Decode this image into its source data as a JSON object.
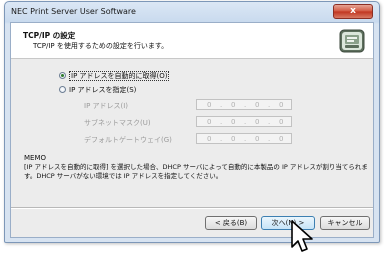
{
  "window": {
    "title": "NEC Print Server User Software",
    "close_label": "x"
  },
  "header": {
    "title": "TCP/IP の設定",
    "subtitle": "TCP/IP を使用するための設定を行います。",
    "icon": "settings-wizard-icon"
  },
  "options": {
    "auto": {
      "label": "IP アドレスを自動的に取得(O)",
      "selected": true
    },
    "manual": {
      "label": "IP アドレスを指定(S)",
      "selected": false
    }
  },
  "fields": [
    {
      "label": "IP アドレス(I)",
      "value": [
        "0",
        "0",
        "0",
        "0"
      ]
    },
    {
      "label": "サブネットマスク(U)",
      "value": [
        "0",
        "0",
        "0",
        "0"
      ]
    },
    {
      "label": "デフォルトゲートウェイ(G)",
      "value": [
        "0",
        "0",
        "0",
        "0"
      ]
    }
  ],
  "memo": {
    "title": "MEMO",
    "text": "[IP アドレスを自動的に取得] を選択した場合、DHCP サーバによって自動的に本製品の IP アドレスが割り当てられます。DHCP サーバがない環境では IP アドレスを指定してください。"
  },
  "buttons": {
    "back": "< 戻る(B)",
    "next": "次へ(N) >",
    "cancel": "キャンセル"
  }
}
